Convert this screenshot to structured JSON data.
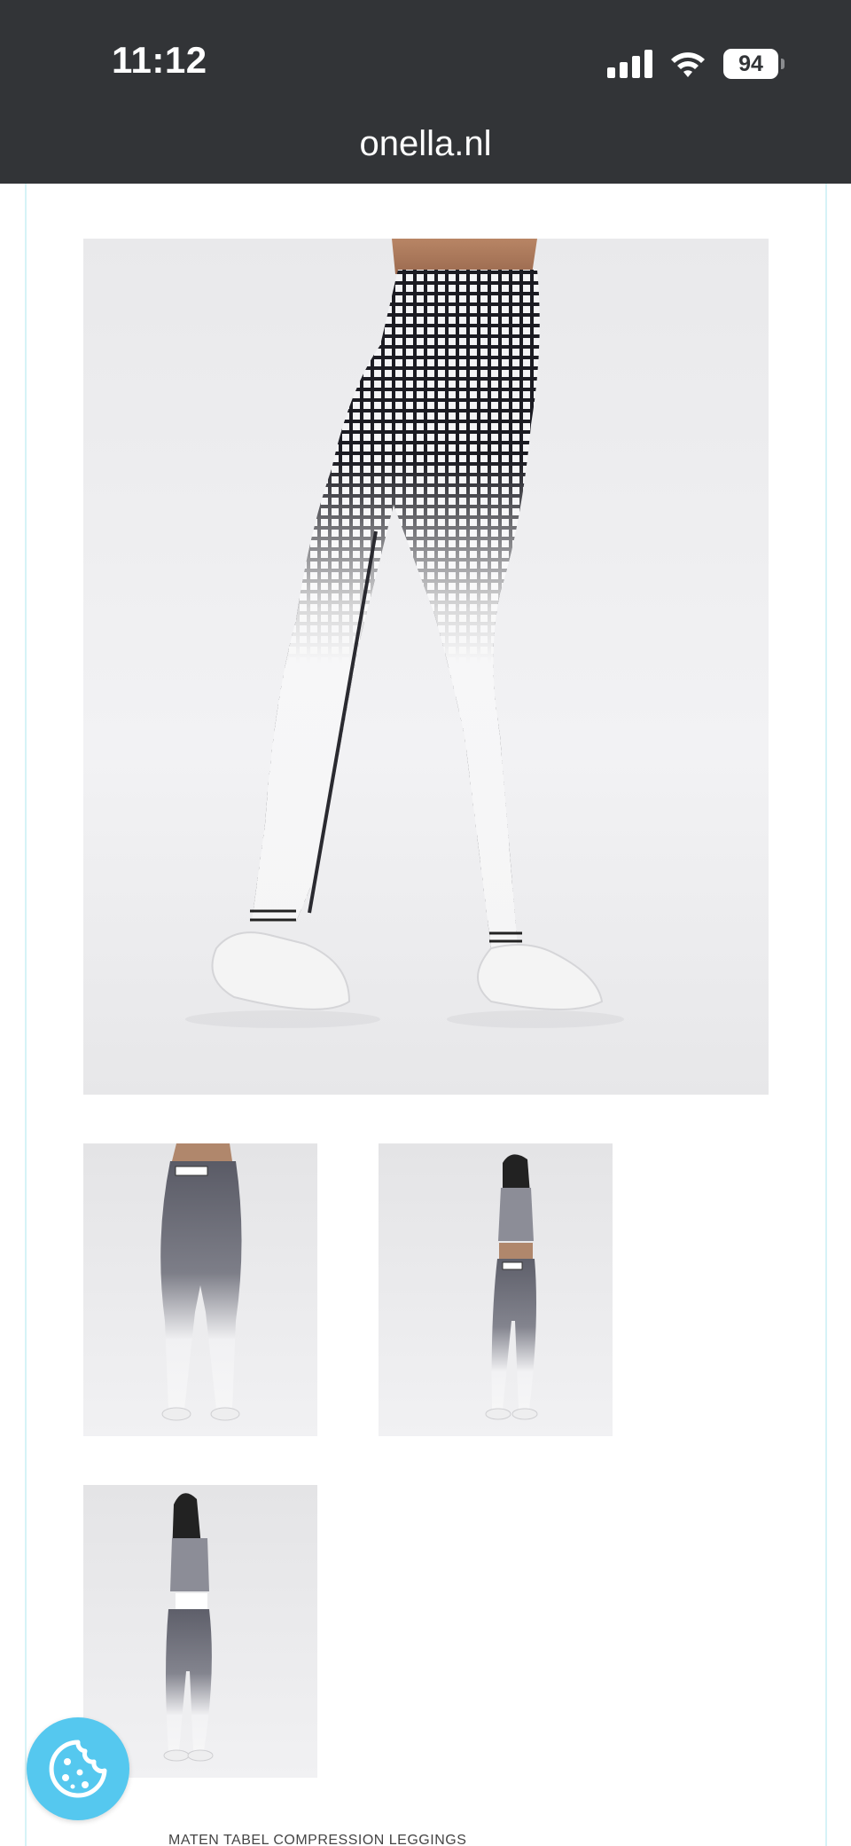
{
  "status_bar": {
    "time": "11:12",
    "battery": "94",
    "icons": [
      "cellular-signal-icon",
      "wifi-icon",
      "battery-icon"
    ]
  },
  "browser": {
    "url": "onella.nl"
  },
  "product": {
    "images": [
      {
        "name": "main-product-photo",
        "subject": "checkered gradient compression leggings, rear view"
      },
      {
        "name": "thumbnail-back-view"
      },
      {
        "name": "thumbnail-front-full-outfit"
      },
      {
        "name": "thumbnail-back-full-outfit"
      }
    ],
    "size_table_caption": "MATEN TABEL COMPRESSION LEGGINGS"
  },
  "cookie_button": {
    "icon": "cookie-icon",
    "color": "#55c8ef"
  },
  "colors": {
    "top_bar": "#323437",
    "frame_border": "#d6f3f7"
  }
}
